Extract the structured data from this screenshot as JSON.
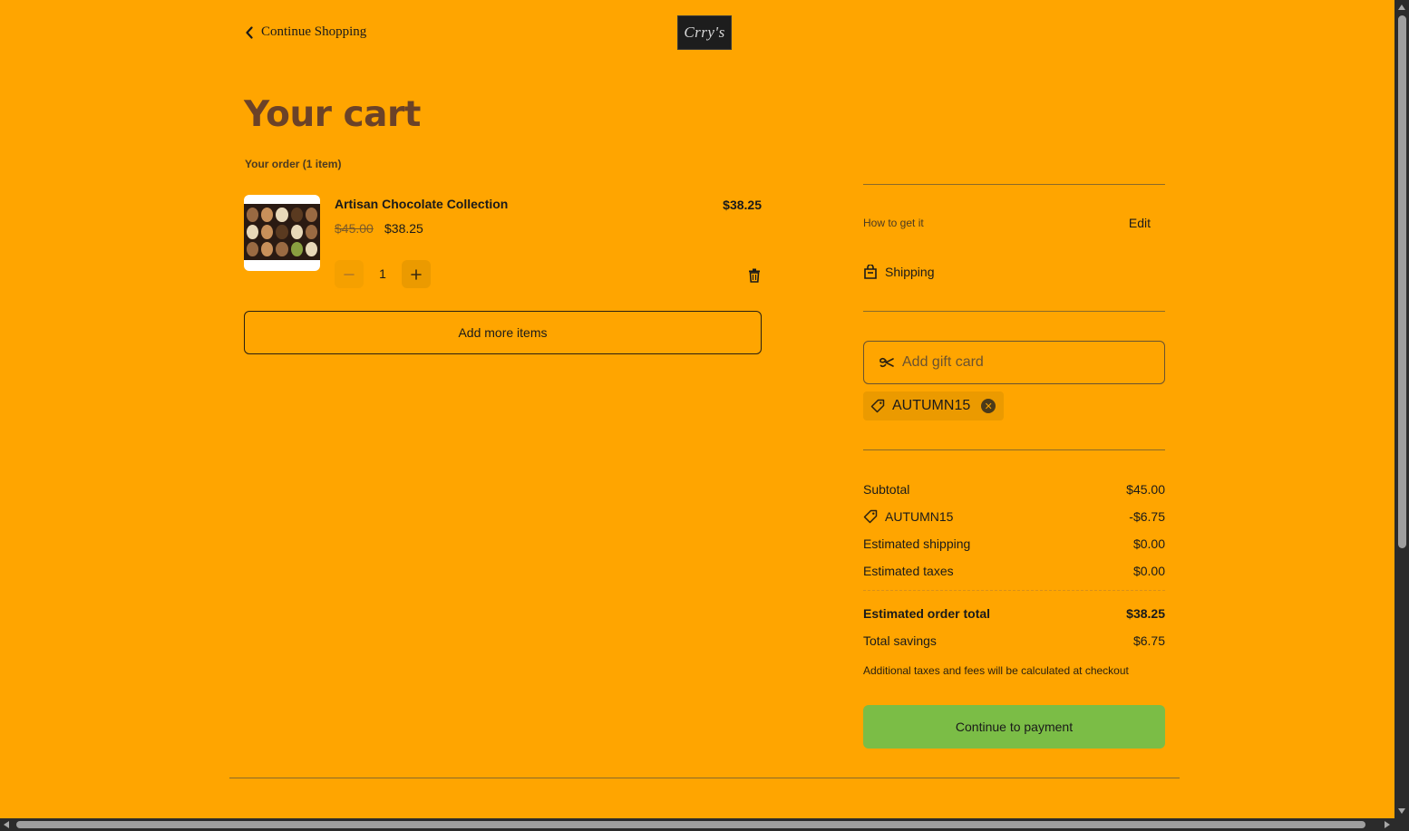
{
  "header": {
    "continue_label": "Continue Shopping",
    "logo_text": "Crry's"
  },
  "cart": {
    "title": "Your cart",
    "order_count": "Your order (1 item)",
    "items": [
      {
        "name": "Artisan Chocolate Collection",
        "original_price": "$45.00",
        "price": "$38.25",
        "line_total": "$38.25",
        "quantity": "1",
        "image_icon": "chocolate-box-image"
      }
    ],
    "add_more_label": "Add more items"
  },
  "fulfillment": {
    "label": "How to get it",
    "edit_label": "Edit",
    "method": "Shipping",
    "method_icon": "shopping-bag-icon"
  },
  "gift_card": {
    "placeholder": "Add gift card",
    "applied_code": "AUTUMN15"
  },
  "summary": {
    "subtotal_label": "Subtotal",
    "subtotal_value": "$45.00",
    "discount_label": "AUTUMN15",
    "discount_value": "-$6.75",
    "shipping_label": "Estimated shipping",
    "shipping_value": "$0.00",
    "taxes_label": "Estimated taxes",
    "taxes_value": "$0.00",
    "total_label": "Estimated order total",
    "total_value": "$38.25",
    "savings_label": "Total savings",
    "savings_value": "$6.75",
    "note": "Additional taxes and fees will be calculated at checkout",
    "pay_label": "Continue to payment"
  },
  "colors": {
    "background": "#FFA500",
    "title": "#6b4228",
    "pay_button": "#7bbd46"
  }
}
